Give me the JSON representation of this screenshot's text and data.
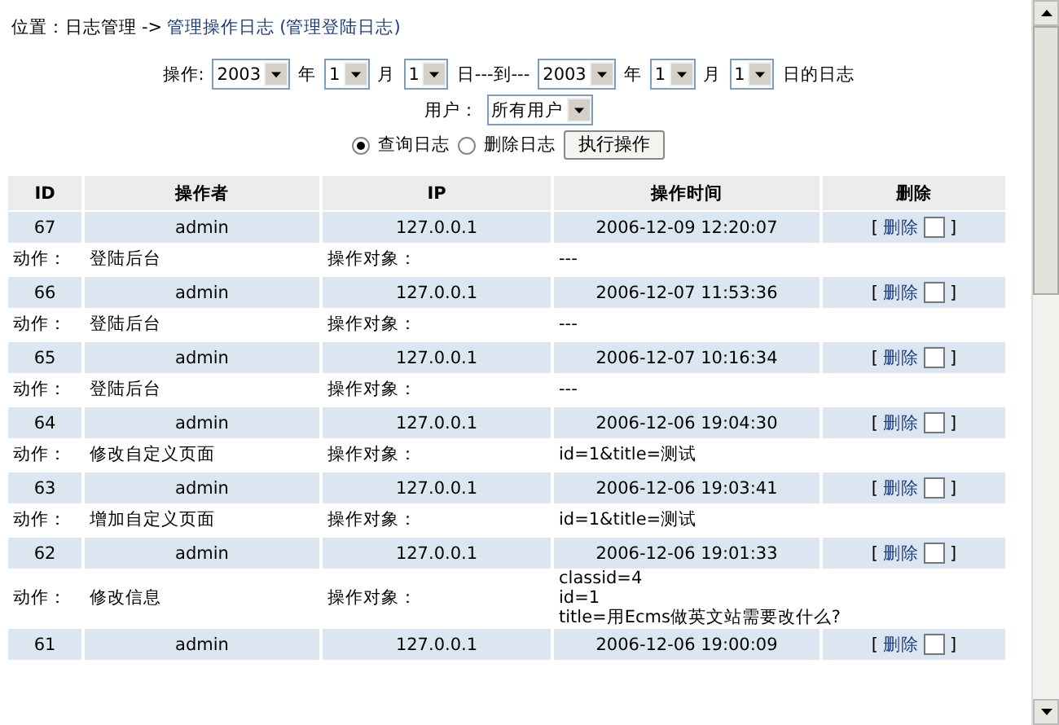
{
  "breadcrumb": {
    "label": "位置：",
    "parent": "日志管理",
    "separator": "->",
    "current": "管理操作日志",
    "alt_link": "(管理登陆日志)"
  },
  "filter": {
    "parts": [
      {
        "kind": "text",
        "text": "操作:"
      },
      {
        "kind": "select",
        "value": "2003"
      },
      {
        "kind": "text",
        "text": "年"
      },
      {
        "kind": "select",
        "value": "1"
      },
      {
        "kind": "text",
        "text": "月"
      },
      {
        "kind": "select",
        "value": "1"
      },
      {
        "kind": "text",
        "text": "日---到---"
      },
      {
        "kind": "select",
        "value": "2003"
      },
      {
        "kind": "text",
        "text": "年"
      },
      {
        "kind": "select",
        "value": "1"
      },
      {
        "kind": "text",
        "text": "月"
      },
      {
        "kind": "select",
        "value": "1"
      },
      {
        "kind": "text",
        "text": "日的日志"
      }
    ]
  },
  "user": {
    "label": "用户：",
    "value": "所有用户"
  },
  "modes": [
    {
      "label": "查询日志",
      "selected": true
    },
    {
      "label": "删除日志",
      "selected": false
    }
  ],
  "submit": "执行操作",
  "table": {
    "columns": [
      "ID",
      "操作者",
      "IP",
      "操作时间",
      "删除"
    ],
    "rows": [
      {
        "id": "67",
        "operator": "admin",
        "ip": "127.0.0.1",
        "time": "2006-12-09 12:20:07",
        "delete": {
          "open": "[",
          "link": "删除",
          "checked": false,
          "close": "]"
        },
        "detail": {
          "action_label": "动作：",
          "action": "登陆后台",
          "target_label": "操作对象：",
          "target": [
            "---"
          ]
        }
      },
      {
        "id": "66",
        "operator": "admin",
        "ip": "127.0.0.1",
        "time": "2006-12-07 11:53:36",
        "delete": {
          "open": "[",
          "link": "删除",
          "checked": false,
          "close": "]"
        },
        "detail": {
          "action_label": "动作：",
          "action": "登陆后台",
          "target_label": "操作对象：",
          "target": [
            "---"
          ]
        }
      },
      {
        "id": "65",
        "operator": "admin",
        "ip": "127.0.0.1",
        "time": "2006-12-07 10:16:34",
        "delete": {
          "open": "[",
          "link": "删除",
          "checked": false,
          "close": "]"
        },
        "detail": {
          "action_label": "动作：",
          "action": "登陆后台",
          "target_label": "操作对象：",
          "target": [
            "---"
          ]
        }
      },
      {
        "id": "64",
        "operator": "admin",
        "ip": "127.0.0.1",
        "time": "2006-12-06 19:04:30",
        "delete": {
          "open": "[",
          "link": "删除",
          "checked": false,
          "close": "]"
        },
        "detail": {
          "action_label": "动作：",
          "action": "修改自定义页面",
          "target_label": "操作对象：",
          "target": [
            "id=1&title=测试"
          ]
        }
      },
      {
        "id": "63",
        "operator": "admin",
        "ip": "127.0.0.1",
        "time": "2006-12-06 19:03:41",
        "delete": {
          "open": "[",
          "link": "删除",
          "checked": false,
          "close": "]"
        },
        "detail": {
          "action_label": "动作：",
          "action": "增加自定义页面",
          "target_label": "操作对象：",
          "target": [
            "id=1&title=测试"
          ]
        }
      },
      {
        "id": "62",
        "operator": "admin",
        "ip": "127.0.0.1",
        "time": "2006-12-06 19:01:33",
        "delete": {
          "open": "[",
          "link": "删除",
          "checked": false,
          "close": "]"
        },
        "detail": {
          "action_label": "动作：",
          "action": "修改信息",
          "target_label": "操作对象：",
          "target": [
            "classid=4",
            "id=1",
            "title=用Ecms做英文站需要改什么?"
          ]
        }
      },
      {
        "id": "61",
        "operator": "admin",
        "ip": "127.0.0.1",
        "time": "2006-12-06 19:00:09",
        "delete": {
          "open": "[",
          "link": "删除",
          "checked": false,
          "close": "]"
        }
      }
    ]
  }
}
